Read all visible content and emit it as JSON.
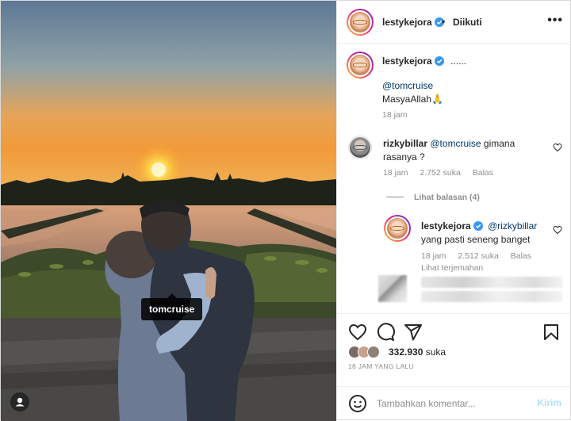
{
  "photo": {
    "tag_label": "tomcruise"
  },
  "header": {
    "username": "lestykejora",
    "separator": "•",
    "follow_label": "Diikuti",
    "more_label": "•••"
  },
  "caption": {
    "username": "lestykejora",
    "text": "......",
    "mention": "@tomcruise",
    "body": "MasyaAllah🙏",
    "time": "18 jam"
  },
  "comments": [
    {
      "username": "rizkybillar",
      "mention": "@tomcruise",
      "text_line1": "gimana",
      "text_line2": "rasanya ?",
      "time": "18 jam",
      "likes": "2.752 suka",
      "reply_label": "Balas"
    }
  ],
  "view_replies_label": "Lihat balasan (4)",
  "reply": {
    "username": "lestykejora",
    "mention": "@rizkybillar",
    "text": "yang pasti seneng banget",
    "time": "18 jam",
    "likes": "2.512 suka",
    "reply_label": "Balas",
    "translate_label": "Lihat terjemahan"
  },
  "post_stats": {
    "likes_count": "332.930",
    "likes_suffix": "suka",
    "time_ago": "18 JAM YANG LALU"
  },
  "composer": {
    "placeholder": "Tambahkan komentar...",
    "send_label": "Kirim"
  },
  "icons": {
    "like": "heart-icon",
    "comment": "comment-icon",
    "share": "send-icon",
    "save": "bookmark-icon",
    "emoji": "emoji-icon",
    "verified": "verified-badge-icon",
    "options": "more-options-icon",
    "tagged_user": "user-tag-icon"
  },
  "colors": {
    "verified_blue": "#3897f0",
    "link_blue": "#00376b",
    "meta_gray": "#8e8e8e",
    "send_disabled": "#b2dffc"
  }
}
